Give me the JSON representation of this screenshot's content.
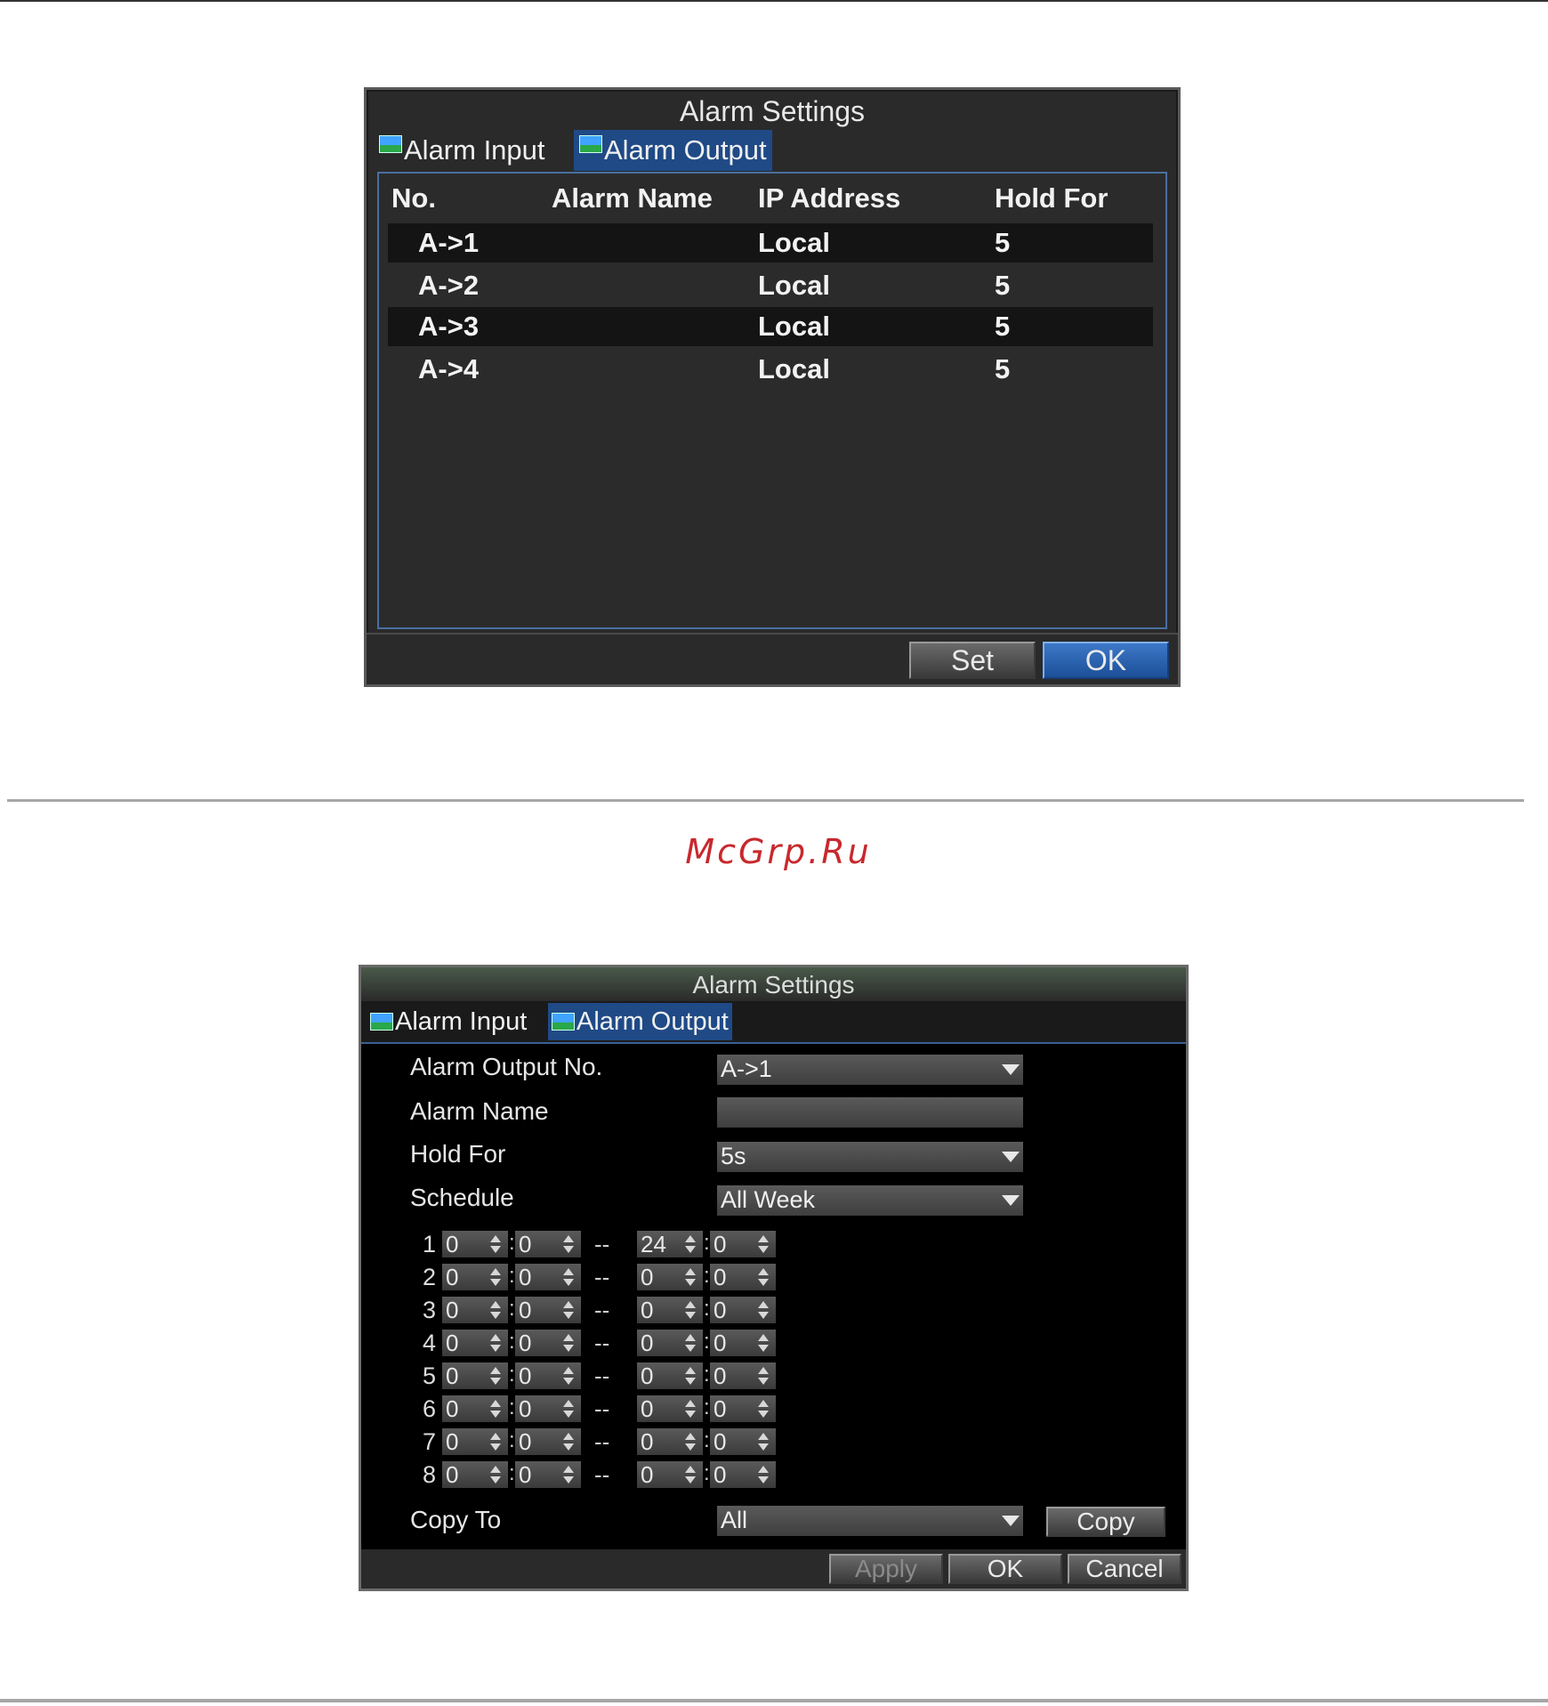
{
  "watermark": "McGrp.Ru",
  "dialog1": {
    "title": "Alarm Settings",
    "tabs": [
      {
        "label": "Alarm Input",
        "active": false
      },
      {
        "label": "Alarm Output",
        "active": true
      }
    ],
    "columns": [
      "No.",
      "Alarm Name",
      "IP Address",
      "Hold For"
    ],
    "rows": [
      {
        "no": "A->1",
        "name": "",
        "ip": "Local",
        "hold": "5"
      },
      {
        "no": "A->2",
        "name": "",
        "ip": "Local",
        "hold": "5"
      },
      {
        "no": "A->3",
        "name": "",
        "ip": "Local",
        "hold": "5"
      },
      {
        "no": "A->4",
        "name": "",
        "ip": "Local",
        "hold": "5"
      }
    ],
    "buttons": {
      "set": "Set",
      "ok": "OK"
    }
  },
  "dialog2": {
    "title": "Alarm Settings",
    "tabs": [
      {
        "label": "Alarm Input",
        "active": false
      },
      {
        "label": "Alarm Output",
        "active": true
      }
    ],
    "fields": {
      "output_no": {
        "label": "Alarm Output No.",
        "value": "A->1"
      },
      "name": {
        "label": "Alarm Name",
        "value": ""
      },
      "hold_for": {
        "label": "Hold For",
        "value": "5s"
      },
      "schedule": {
        "label": "Schedule",
        "value": "All Week"
      }
    },
    "time_separator": "--",
    "time_rows": [
      {
        "n": "1",
        "start_h": "0",
        "start_m": "0",
        "end_h": "24",
        "end_m": "0"
      },
      {
        "n": "2",
        "start_h": "0",
        "start_m": "0",
        "end_h": "0",
        "end_m": "0"
      },
      {
        "n": "3",
        "start_h": "0",
        "start_m": "0",
        "end_h": "0",
        "end_m": "0"
      },
      {
        "n": "4",
        "start_h": "0",
        "start_m": "0",
        "end_h": "0",
        "end_m": "0"
      },
      {
        "n": "5",
        "start_h": "0",
        "start_m": "0",
        "end_h": "0",
        "end_m": "0"
      },
      {
        "n": "6",
        "start_h": "0",
        "start_m": "0",
        "end_h": "0",
        "end_m": "0"
      },
      {
        "n": "7",
        "start_h": "0",
        "start_m": "0",
        "end_h": "0",
        "end_m": "0"
      },
      {
        "n": "8",
        "start_h": "0",
        "start_m": "0",
        "end_h": "0",
        "end_m": "0"
      }
    ],
    "copy_to": {
      "label": "Copy To",
      "value": "All",
      "button": "Copy"
    },
    "buttons": {
      "apply": "Apply",
      "ok": "OK",
      "cancel": "Cancel"
    }
  }
}
